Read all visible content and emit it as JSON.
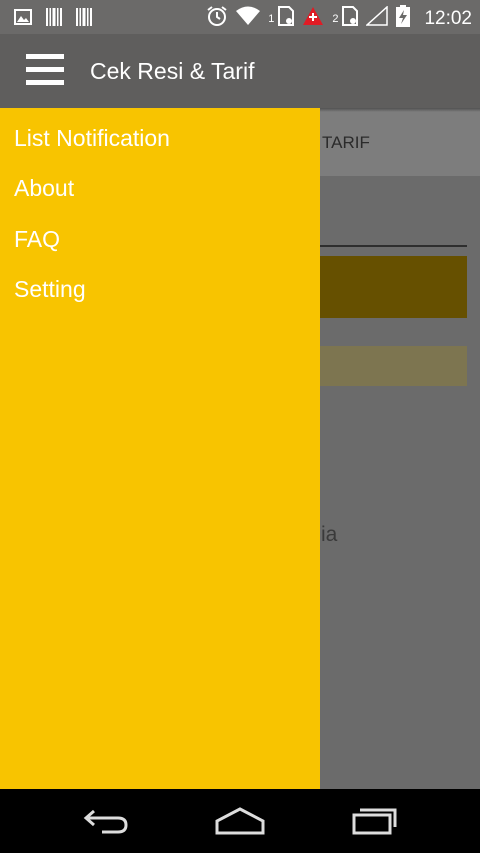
{
  "status_bar": {
    "time": "12:02",
    "sim1_label": "1",
    "sim2_label": "2",
    "icons_left": [
      "picture-icon",
      "barcode-icon",
      "barcode-icon"
    ],
    "icons_right": [
      "alarm-icon",
      "wifi-icon",
      "sim1-icon",
      "alert-icon",
      "sim2-icon",
      "signal-icon",
      "battery-charging-icon"
    ]
  },
  "app_bar": {
    "title": "Cek Resi & Tarif",
    "background": "#5f5e5d"
  },
  "background_view": {
    "tab_label": "TARIF",
    "partial_text": "ia",
    "accent_dimmed": "#665000"
  },
  "drawer": {
    "background": "#f8c400",
    "items": [
      {
        "label": "List Notification"
      },
      {
        "label": "About"
      },
      {
        "label": "FAQ"
      },
      {
        "label": "Setting"
      }
    ]
  },
  "nav_bar": {
    "buttons": [
      "back-icon",
      "home-icon",
      "recents-icon"
    ]
  }
}
